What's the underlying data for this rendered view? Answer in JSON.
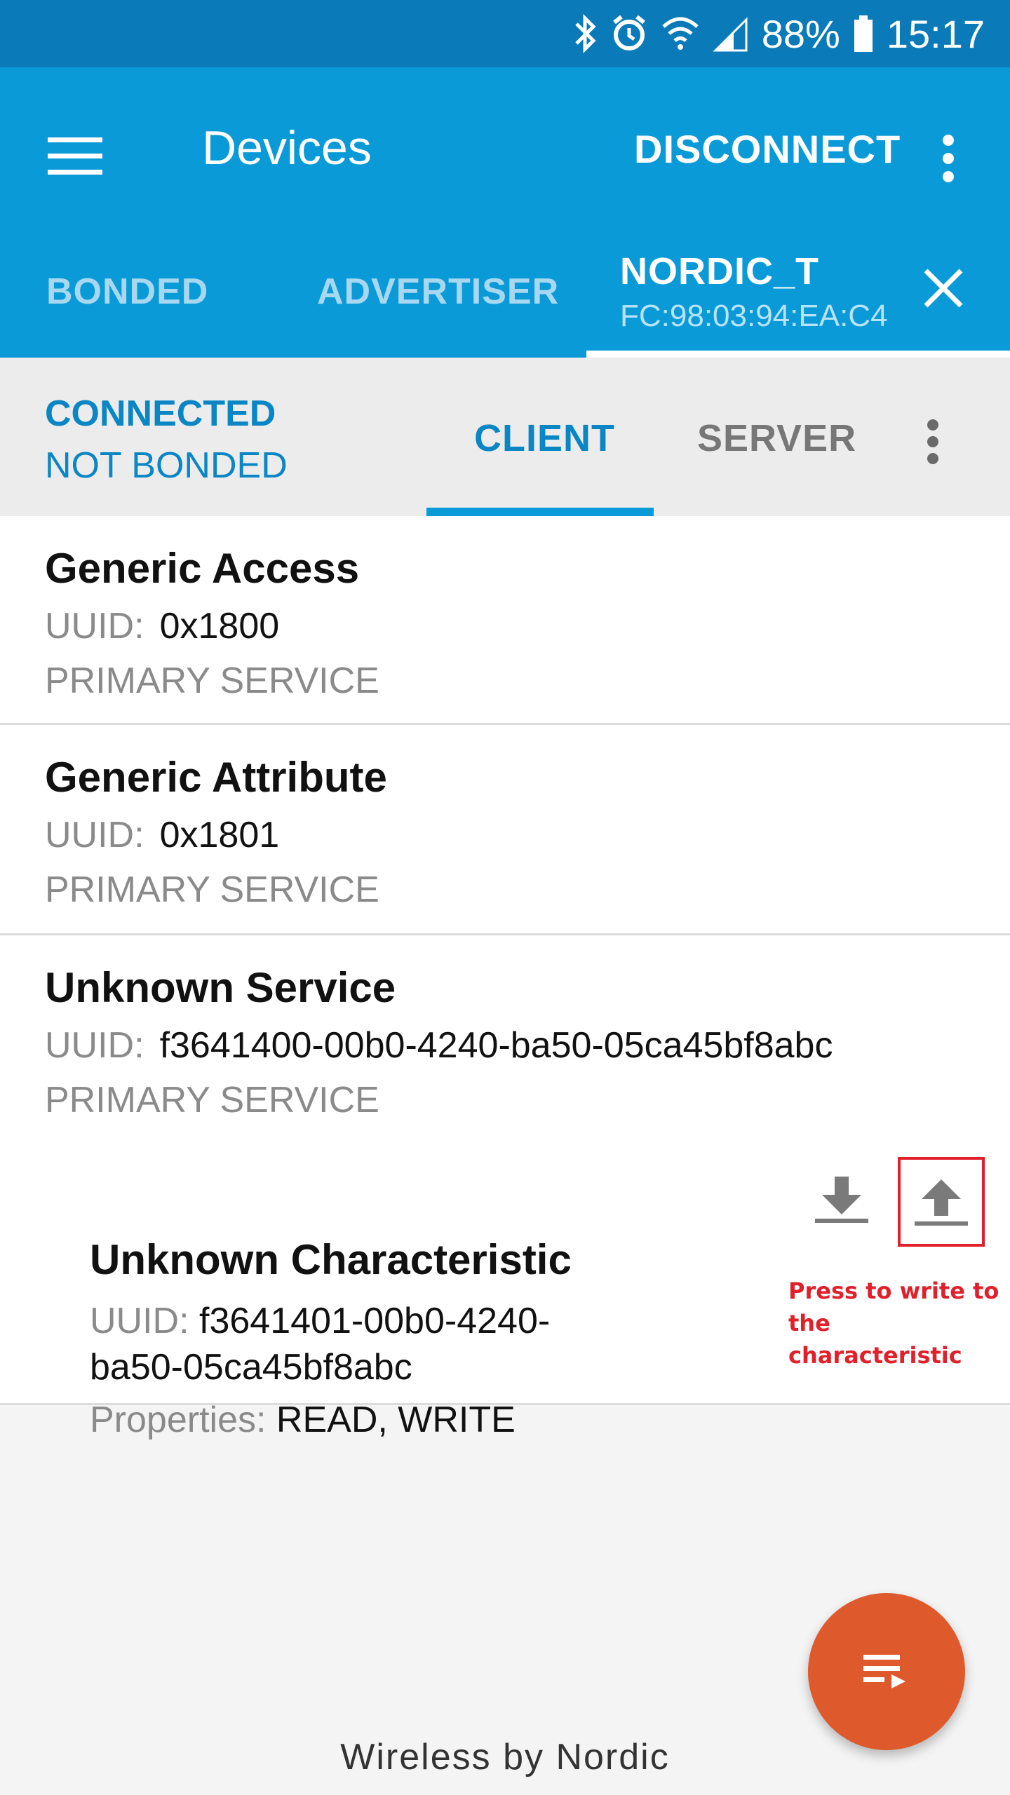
{
  "status_bar": {
    "battery": "88%",
    "time": "15:17",
    "icons": [
      "bluetooth-icon",
      "alarm-icon",
      "wifi-icon",
      "signal-icon",
      "battery-icon"
    ]
  },
  "app_bar": {
    "title": "Devices",
    "disconnect_label": "DISCONNECT",
    "color": "#0a9ad8"
  },
  "device_tabs": {
    "bonded": "BONDED",
    "advertiser": "ADVERTISER",
    "device_name": "NORDIC_T",
    "device_mac": "FC:98:03:94:EA:C4"
  },
  "connection": {
    "state": "CONNECTED",
    "bond": "NOT BONDED",
    "tab_client": "CLIENT",
    "tab_server": "SERVER"
  },
  "services": [
    {
      "name": "Generic Access",
      "uuid_label": "UUID:",
      "uuid": "0x1800",
      "type": "PRIMARY SERVICE"
    },
    {
      "name": "Generic Attribute",
      "uuid_label": "UUID:",
      "uuid": "0x1801",
      "type": "PRIMARY SERVICE"
    },
    {
      "name": "Unknown Service",
      "uuid_label": "UUID:",
      "uuid": "f3641400-00b0-4240-ba50-05ca45bf8abc",
      "type": "PRIMARY SERVICE",
      "characteristic": {
        "name": "Unknown Characteristic",
        "uuid_label": "UUID:",
        "uuid": "f3641401-00b0-4240-ba50-05ca45bf8abc",
        "properties_label": "Properties:",
        "properties": "READ, WRITE"
      }
    }
  ],
  "annotation": "Press to write to the characteristic",
  "footer": "Wireless by Nordic",
  "accent_colors": {
    "fab": "#de5a2c",
    "annotation": "#e0202a",
    "link": "#0a86c4"
  }
}
